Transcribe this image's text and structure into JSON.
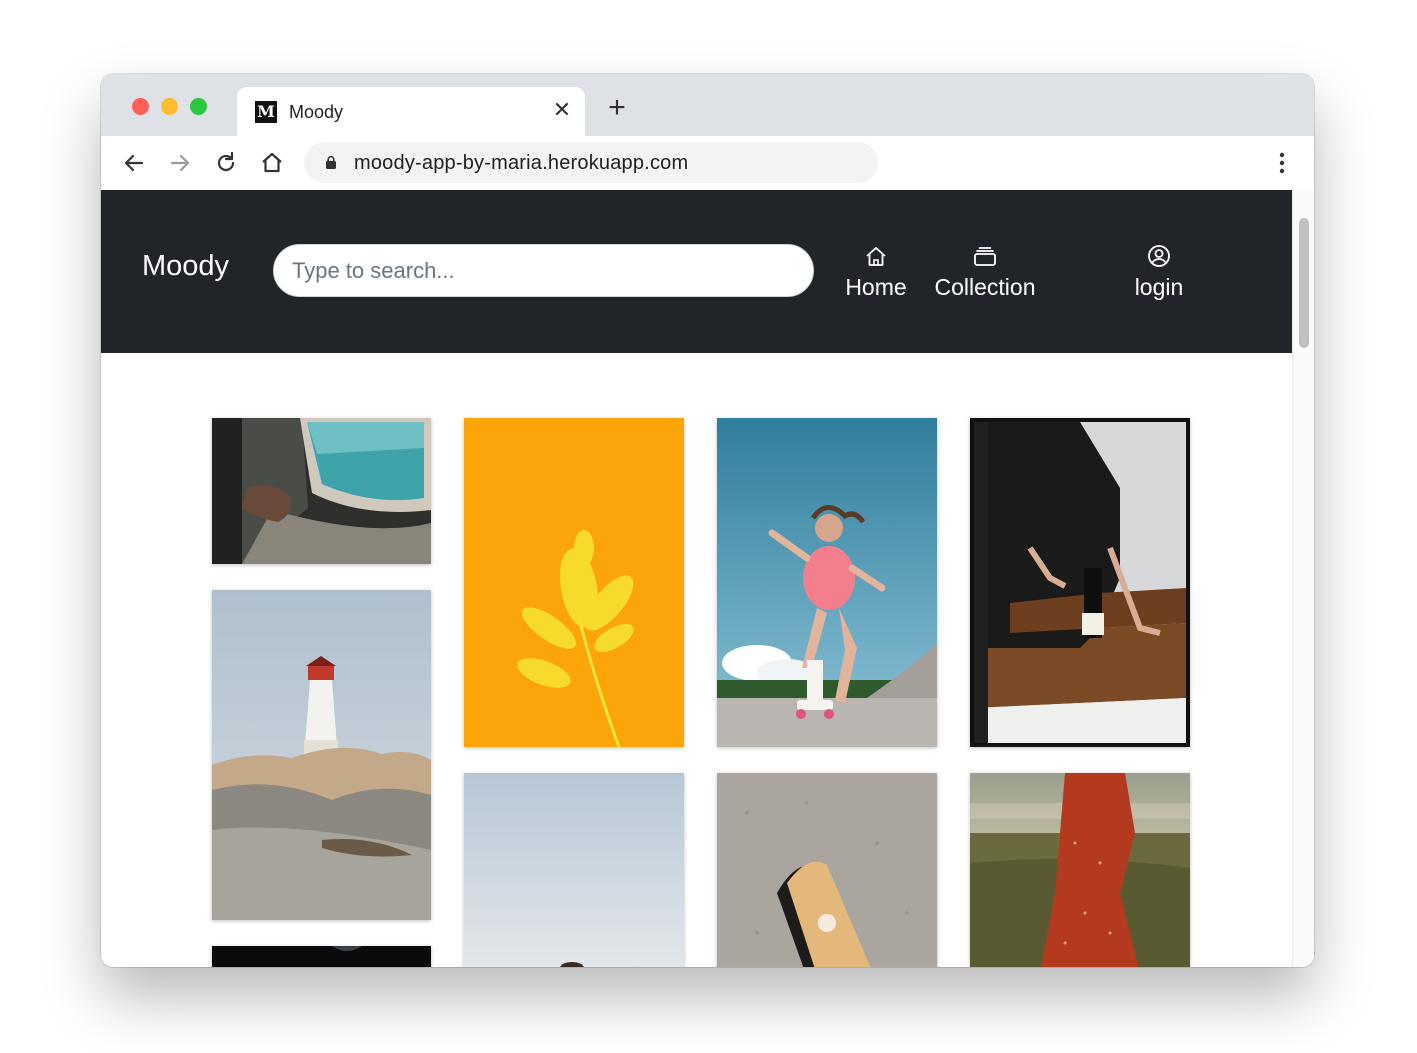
{
  "browser": {
    "tab_title": "Moody",
    "favicon_letter": "M",
    "close_glyph": "✕",
    "newtab_glyph": "+",
    "url": "moody-app-by-maria.herokuapp.com"
  },
  "navbar": {
    "brand": "Moody",
    "search_placeholder": "Type to search...",
    "links": [
      {
        "label": "Home",
        "icon": "house-icon"
      },
      {
        "label": "Collection",
        "icon": "collection-icon"
      },
      {
        "label": "login",
        "icon": "person-circle-icon"
      }
    ]
  },
  "colors": {
    "navbar_bg": "#212529",
    "tabstrip_bg": "#dee1e6",
    "traffic_red": "#ff5f57",
    "traffic_yellow": "#febc2e",
    "traffic_green": "#28c840"
  },
  "gallery": {
    "photos": [
      {
        "subject": "hand-by-train-window-photo"
      },
      {
        "subject": "lighthouse-on-rocks-photo"
      },
      {
        "subject": "dark-abstract-photo"
      },
      {
        "subject": "yellow-leaf-on-orange-photo"
      },
      {
        "subject": "pale-sky-photo"
      },
      {
        "subject": "roller-skater-photo"
      },
      {
        "subject": "skateboard-on-asphalt-photo"
      },
      {
        "subject": "stairs-with-champagne-photo"
      },
      {
        "subject": "woman-in-red-dress-photo"
      }
    ]
  }
}
